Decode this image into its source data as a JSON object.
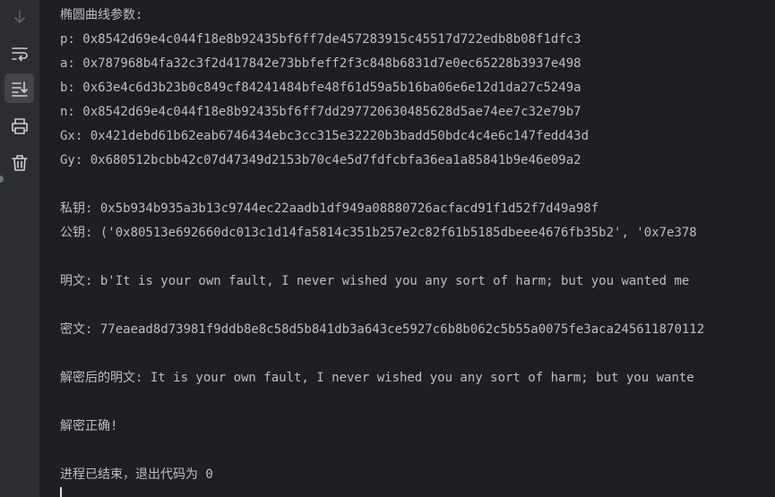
{
  "toolbar": {
    "icons": [
      "arrow-down-icon",
      "soft-wrap-icon",
      "scroll-to-end-icon",
      "print-icon",
      "trash-icon"
    ]
  },
  "console": {
    "lines": [
      "椭圆曲线参数:",
      "p: 0x8542d69e4c044f18e8b92435bf6ff7de457283915c45517d722edb8b08f1dfc3",
      "a: 0x787968b4fa32c3f2d417842e73bbfeff2f3c848b6831d7e0ec65228b3937e498",
      "b: 0x63e4c6d3b23b0c849cf84241484bfe48f61d59a5b16ba06e6e12d1da27c5249a",
      "n: 0x8542d69e4c044f18e8b92435bf6ff7dd297720630485628d5ae74ee7c32e79b7",
      "Gx: 0x421debd61b62eab6746434ebc3cc315e32220b3badd50bdc4c4e6c147fedd43d",
      "Gy: 0x680512bcbb42c07d47349d2153b70c4e5d7fdfcbfa36ea1a85841b9e46e09a2",
      "私钥: 0x5b934b935a3b13c9744ec22aadb1df949a08880726acfacd91f1d52f7d49a98f",
      "公钥: ('0x80513e692660dc013c1d14fa5814c351b257e2c82f61b5185dbeee4676fb35b2', '0x7e378",
      "明文: b'It is your own fault, I never wished you any sort of harm; but you wanted me",
      "密文: 77eaead8d73981f9ddb8e8c58d5b841db3a643ce5927c6b8b062c5b55a0075fe3aca245611870112",
      "解密后的明文: It is your own fault, I never wished you any sort of harm; but you wante",
      "解密正确!",
      "进程已结束，退出代码为 0"
    ]
  }
}
